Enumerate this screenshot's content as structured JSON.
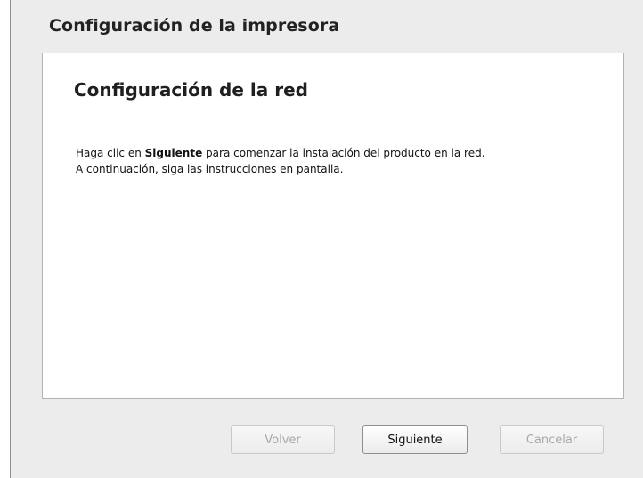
{
  "window": {
    "title": "Configuración de la impresora"
  },
  "panel": {
    "heading": "Configuración de la red",
    "instructions": {
      "line1_prefix": "Haga clic en ",
      "line1_bold": "Siguiente",
      "line1_suffix": " para comenzar la instalación del producto en la red.",
      "line2": "A continuación, siga las instrucciones en pantalla."
    }
  },
  "buttons": {
    "back_label": "Volver",
    "next_label": "Siguiente",
    "cancel_label": "Cancelar"
  },
  "button_states": {
    "back_enabled": false,
    "next_enabled": true,
    "cancel_enabled": false
  }
}
